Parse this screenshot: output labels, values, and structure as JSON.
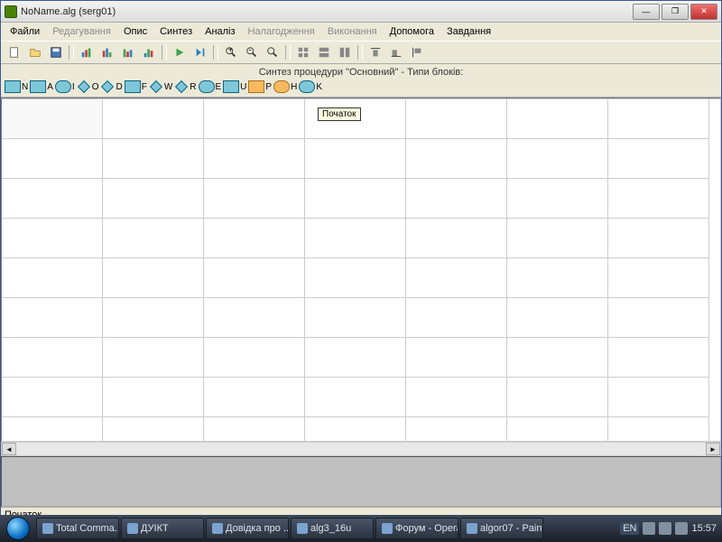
{
  "title": "NoName.alg (serg01)",
  "menu": {
    "items": [
      "Файли",
      "Редагування",
      "Опис",
      "Синтез",
      "Аналіз",
      "Налагодження",
      "Виконання",
      "Допомога",
      "Завдання"
    ],
    "disabled": [
      1,
      5,
      6
    ]
  },
  "blocks": {
    "label": "Синтез процедури \"Основний\" - Типи блоків:",
    "letters": [
      "N",
      "A",
      "I",
      "O",
      "D",
      "F",
      "W",
      "R",
      "E",
      "U",
      "P",
      "H",
      "K"
    ]
  },
  "tooltip": "Початок",
  "status": "Початок",
  "taskbar": {
    "items": [
      "Total Comma...",
      "ДУIКТ",
      "Довідка про ...",
      "alg3_16u",
      "Форум - Opera",
      "algor07 - Paint"
    ],
    "lang": "EN",
    "clock": "15:57"
  }
}
